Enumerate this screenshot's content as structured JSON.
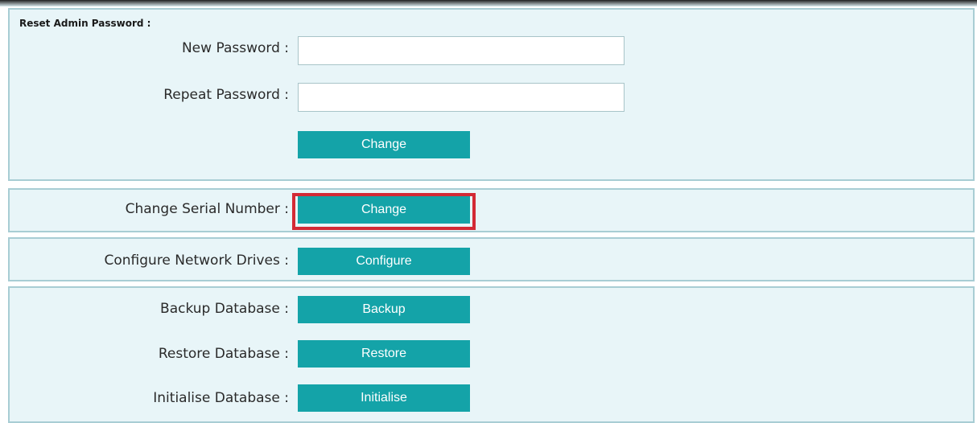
{
  "reset_admin_password": {
    "section_title": "Reset Admin Password :",
    "new_password_label": "New Password :",
    "new_password_value": "",
    "repeat_password_label": "Repeat Password :",
    "repeat_password_value": "",
    "change_button": "Change"
  },
  "serial_number": {
    "label": "Change Serial Number :",
    "button": "Change",
    "highlighted": true,
    "highlight_color": "#d32a35"
  },
  "network_drives": {
    "label": "Configure Network Drives :",
    "button": "Configure"
  },
  "database": {
    "backup_label": "Backup Database :",
    "backup_button": "Backup",
    "restore_label": "Restore Database :",
    "restore_button": "Restore",
    "initialise_label": "Initialise Database :",
    "initialise_button": "Initialise"
  },
  "colors": {
    "panel_background": "#e8f5f8",
    "panel_border": "#a8cdd4",
    "button_background": "#14a3a8",
    "button_text": "#ffffff"
  }
}
